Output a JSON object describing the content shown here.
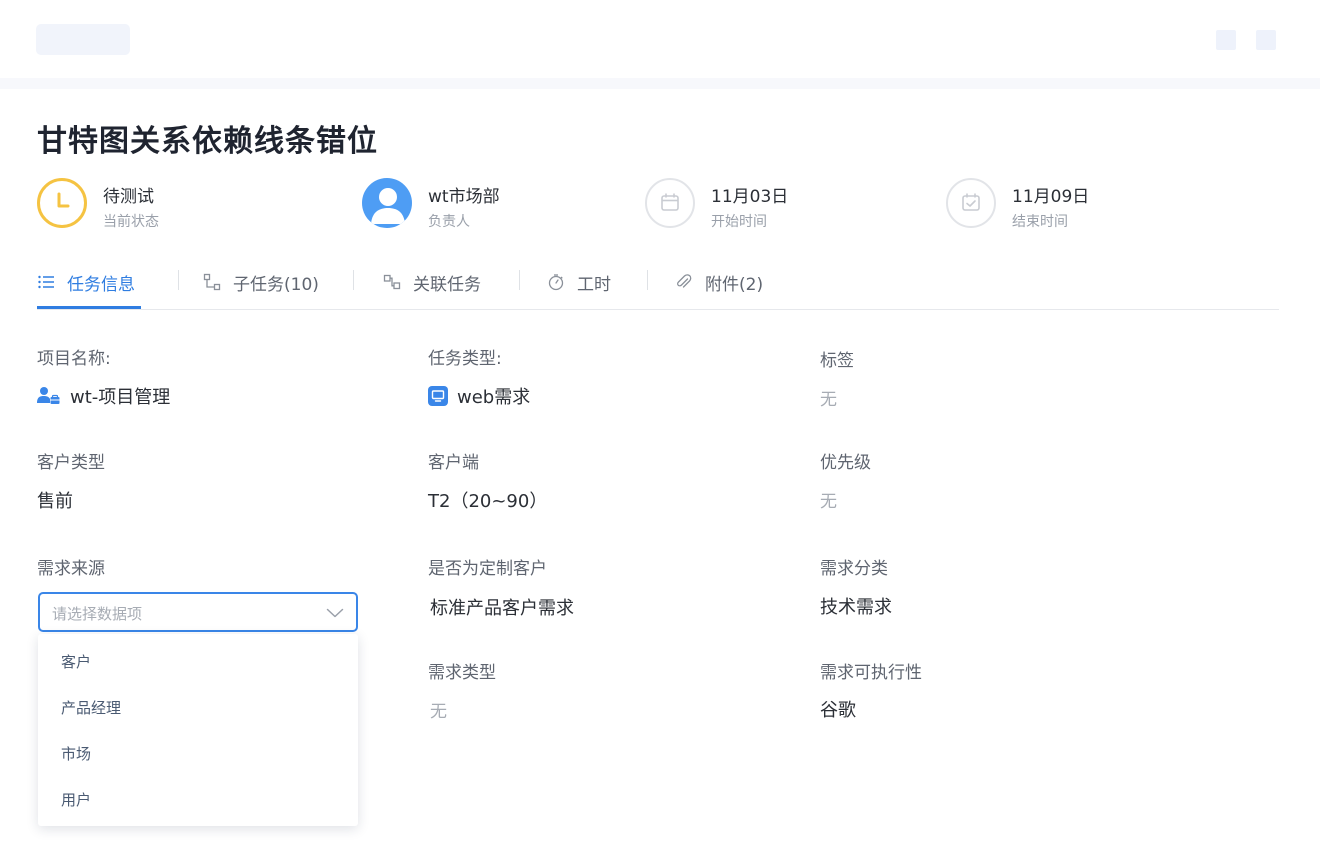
{
  "task": {
    "title": "甘特图关系依赖线条错位"
  },
  "meta": {
    "status": {
      "value": "待测试",
      "label": "当前状态",
      "icon": "clock-icon",
      "color": "#f5c342"
    },
    "owner": {
      "value": "wt市场部",
      "label": "负责人",
      "icon": "user-avatar-icon",
      "color": "#4e9df4"
    },
    "start": {
      "value": "11月03日",
      "label": "开始时间",
      "icon": "calendar-icon"
    },
    "end": {
      "value": "11月09日",
      "label": "结束时间",
      "icon": "calendar-check-icon"
    }
  },
  "tabs": [
    {
      "label": "任务信息",
      "icon": "list-icon",
      "active": true
    },
    {
      "label": "子任务(10)",
      "icon": "subtask-icon"
    },
    {
      "label": "关联任务",
      "icon": "link-task-icon"
    },
    {
      "label": "工时",
      "icon": "stopwatch-icon"
    },
    {
      "label": "附件(2)",
      "icon": "paperclip-icon"
    }
  ],
  "fields": {
    "project": {
      "label": "项目名称:",
      "value": "wt-项目管理",
      "icon": "project-user-icon"
    },
    "task_type": {
      "label": "任务类型:",
      "value": "web需求",
      "icon": "monitor-icon"
    },
    "tags": {
      "label": "标签",
      "value": "无"
    },
    "customer_type": {
      "label": "客户类型",
      "value": "售前"
    },
    "client": {
      "label": "客户端",
      "value": "T2（20~90）"
    },
    "priority": {
      "label": "优先级",
      "value": "无"
    },
    "demand_source": {
      "label": "需求来源",
      "placeholder": "请选择数据项"
    },
    "custom_customer": {
      "label": "是否为定制客户",
      "value": "标准产品客户需求"
    },
    "demand_category": {
      "label": "需求分类",
      "value": "技术需求"
    },
    "demand_type": {
      "label": "需求类型",
      "value": "无"
    },
    "feasibility": {
      "label": "需求可执行性",
      "value": "谷歌"
    }
  },
  "dropdown": {
    "options": [
      "客户",
      "产品经理",
      "市场",
      "用户"
    ]
  },
  "colors": {
    "accent": "#2f7de1",
    "focus_border": "#3a86e8",
    "status": "#f5c342"
  }
}
